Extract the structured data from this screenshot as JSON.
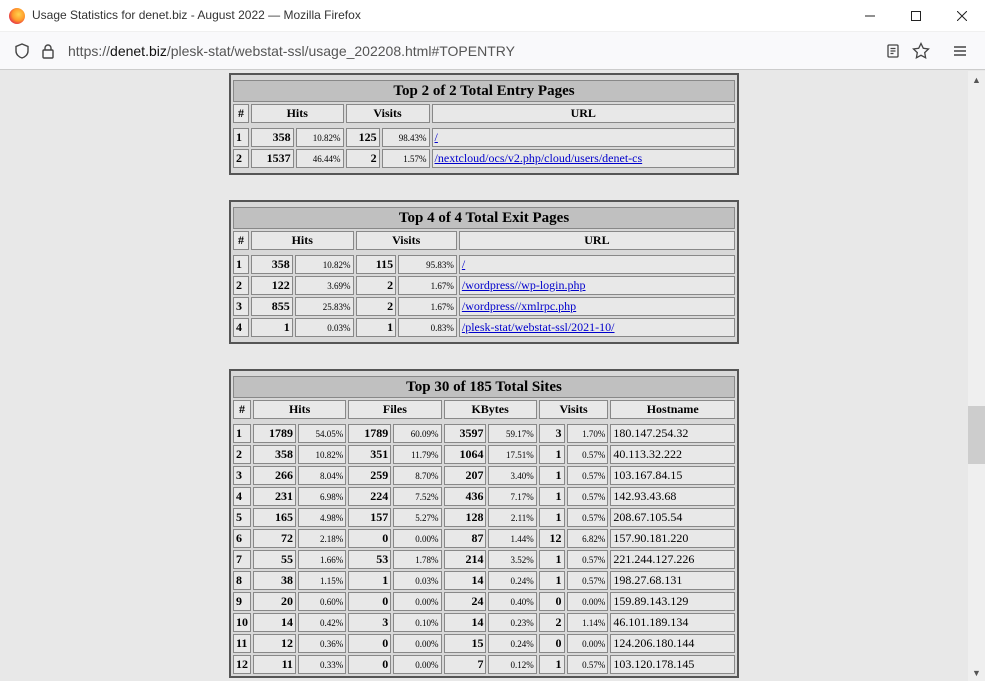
{
  "window": {
    "title": "Usage Statistics for denet.biz - August 2022 — Mozilla Firefox"
  },
  "navbar": {
    "url_prefix": "https://",
    "url_domain": "denet.biz",
    "url_path": "/plesk-stat/webstat-ssl/usage_202208.html#TOPENTRY"
  },
  "icons": {
    "logo": "firefox-logo-icon",
    "shield": "shield-icon",
    "lock": "lock-icon",
    "reader": "reader-view-icon",
    "star": "bookmark-star-icon",
    "menu": "hamburger-menu-icon"
  },
  "colors": {
    "hits": "#00805c",
    "files": "#0040ff",
    "kbytes": "#ff0000",
    "visits": "#ffff00",
    "url": "#00e0ff"
  },
  "entry": {
    "title": "Top 2 of 2 Total Entry Pages",
    "headers": {
      "num": "#",
      "hits": "Hits",
      "visits": "Visits",
      "url": "URL"
    },
    "rows": [
      {
        "n": "1",
        "hits": "358",
        "hits_pct": "10.82%",
        "visits": "125",
        "visits_pct": "98.43%",
        "url": "/"
      },
      {
        "n": "2",
        "hits": "1537",
        "hits_pct": "46.44%",
        "visits": "2",
        "visits_pct": "1.57%",
        "url": "/nextcloud/ocs/v2.php/cloud/users/denet-cs"
      }
    ]
  },
  "exit": {
    "title": "Top 4 of 4 Total Exit Pages",
    "headers": {
      "num": "#",
      "hits": "Hits",
      "visits": "Visits",
      "url": "URL"
    },
    "rows": [
      {
        "n": "1",
        "hits": "358",
        "hits_pct": "10.82%",
        "visits": "115",
        "visits_pct": "95.83%",
        "url": "/"
      },
      {
        "n": "2",
        "hits": "122",
        "hits_pct": "3.69%",
        "visits": "2",
        "visits_pct": "1.67%",
        "url": "/wordpress//wp-login.php"
      },
      {
        "n": "3",
        "hits": "855",
        "hits_pct": "25.83%",
        "visits": "2",
        "visits_pct": "1.67%",
        "url": "/wordpress//xmlrpc.php"
      },
      {
        "n": "4",
        "hits": "1",
        "hits_pct": "0.03%",
        "visits": "1",
        "visits_pct": "0.83%",
        "url": "/plesk-stat/webstat-ssl/2021-10/"
      }
    ]
  },
  "sites": {
    "title": "Top 30 of 185 Total Sites",
    "headers": {
      "num": "#",
      "hits": "Hits",
      "files": "Files",
      "kbytes": "KBytes",
      "visits": "Visits",
      "host": "Hostname"
    },
    "rows": [
      {
        "n": "1",
        "hits": "1789",
        "hits_pct": "54.05%",
        "files": "1789",
        "files_pct": "60.09%",
        "kb": "3597",
        "kb_pct": "59.17%",
        "visits": "3",
        "visits_pct": "1.70%",
        "host": "180.147.254.32"
      },
      {
        "n": "2",
        "hits": "358",
        "hits_pct": "10.82%",
        "files": "351",
        "files_pct": "11.79%",
        "kb": "1064",
        "kb_pct": "17.51%",
        "visits": "1",
        "visits_pct": "0.57%",
        "host": "40.113.32.222"
      },
      {
        "n": "3",
        "hits": "266",
        "hits_pct": "8.04%",
        "files": "259",
        "files_pct": "8.70%",
        "kb": "207",
        "kb_pct": "3.40%",
        "visits": "1",
        "visits_pct": "0.57%",
        "host": "103.167.84.15"
      },
      {
        "n": "4",
        "hits": "231",
        "hits_pct": "6.98%",
        "files": "224",
        "files_pct": "7.52%",
        "kb": "436",
        "kb_pct": "7.17%",
        "visits": "1",
        "visits_pct": "0.57%",
        "host": "142.93.43.68"
      },
      {
        "n": "5",
        "hits": "165",
        "hits_pct": "4.98%",
        "files": "157",
        "files_pct": "5.27%",
        "kb": "128",
        "kb_pct": "2.11%",
        "visits": "1",
        "visits_pct": "0.57%",
        "host": "208.67.105.54"
      },
      {
        "n": "6",
        "hits": "72",
        "hits_pct": "2.18%",
        "files": "0",
        "files_pct": "0.00%",
        "kb": "87",
        "kb_pct": "1.44%",
        "visits": "12",
        "visits_pct": "6.82%",
        "host": "157.90.181.220"
      },
      {
        "n": "7",
        "hits": "55",
        "hits_pct": "1.66%",
        "files": "53",
        "files_pct": "1.78%",
        "kb": "214",
        "kb_pct": "3.52%",
        "visits": "1",
        "visits_pct": "0.57%",
        "host": "221.244.127.226"
      },
      {
        "n": "8",
        "hits": "38",
        "hits_pct": "1.15%",
        "files": "1",
        "files_pct": "0.03%",
        "kb": "14",
        "kb_pct": "0.24%",
        "visits": "1",
        "visits_pct": "0.57%",
        "host": "198.27.68.131"
      },
      {
        "n": "9",
        "hits": "20",
        "hits_pct": "0.60%",
        "files": "0",
        "files_pct": "0.00%",
        "kb": "24",
        "kb_pct": "0.40%",
        "visits": "0",
        "visits_pct": "0.00%",
        "host": "159.89.143.129"
      },
      {
        "n": "10",
        "hits": "14",
        "hits_pct": "0.42%",
        "files": "3",
        "files_pct": "0.10%",
        "kb": "14",
        "kb_pct": "0.23%",
        "visits": "2",
        "visits_pct": "1.14%",
        "host": "46.101.189.134"
      },
      {
        "n": "11",
        "hits": "12",
        "hits_pct": "0.36%",
        "files": "0",
        "files_pct": "0.00%",
        "kb": "15",
        "kb_pct": "0.24%",
        "visits": "0",
        "visits_pct": "0.00%",
        "host": "124.206.180.144"
      },
      {
        "n": "12",
        "hits": "11",
        "hits_pct": "0.33%",
        "files": "0",
        "files_pct": "0.00%",
        "kb": "7",
        "kb_pct": "0.12%",
        "visits": "1",
        "visits_pct": "0.57%",
        "host": "103.120.178.145"
      }
    ]
  }
}
